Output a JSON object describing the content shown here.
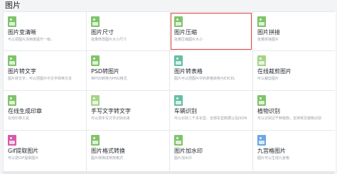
{
  "section": {
    "title": "图片"
  },
  "cards": [
    {
      "title": "图片变清晰",
      "desc": "可以把图片清晰度提升一级。",
      "icon": "image-enhance-icon",
      "color": "#7fc46a",
      "selected": false
    },
    {
      "title": "图片尺寸",
      "desc": "批量修改图片大小尺寸",
      "icon": "image-resize-icon",
      "color": "#7fc46a",
      "selected": false
    },
    {
      "title": "图片压缩",
      "desc": "批量压缩图片大小",
      "icon": "image-compress-icon",
      "color": "#7fc46a",
      "selected": true
    },
    {
      "title": "图片拼接",
      "desc": "批量拼接图片",
      "icon": "image-stitch-icon",
      "color": "#7fc46a",
      "selected": false
    },
    {
      "title": "图片转文字",
      "desc": "图片转文字，可以把图片中文字转换文本",
      "icon": "image-to-text-icon",
      "color": "#7fc46a",
      "selected": false
    },
    {
      "title": "PSD转图片",
      "desc": "将PSD转换为PNG格式",
      "icon": "psd-to-image-icon",
      "color": "#7fc46a",
      "selected": false
    },
    {
      "title": "图片转表格",
      "desc": "图片可以把图片中的表格转换为EXCEL",
      "icon": "image-to-table-icon",
      "color": "#65bfa3",
      "selected": false
    },
    {
      "title": "在线裁剪图片",
      "desc": "可以裁剪图片",
      "icon": "image-crop-icon",
      "color": "#a5d487",
      "selected": false
    },
    {
      "title": "在线生成印章",
      "desc": "在线印章工具",
      "icon": "seal-generator-icon",
      "color": "#7fc46a",
      "selected": false
    },
    {
      "title": "手写文字转文字",
      "desc": "可以把手写文字识别出来",
      "icon": "handwriting-icon",
      "color": "#a5d487",
      "selected": false
    },
    {
      "title": "车辆识别",
      "desc": "可以识别二千多车型、全部车型数据以及JSON",
      "icon": "vehicle-recognition-icon",
      "color": "#65bfa3",
      "selected": false
    },
    {
      "title": "植物识别",
      "desc": "可以识别过千种植物，支持常见植物识别",
      "icon": "plant-recognition-icon",
      "color": "#7fc46a",
      "selected": false
    },
    {
      "title": "Gif提取图片",
      "desc": "可以把GIF提取图片",
      "icon": "gif-extract-icon",
      "color": "#d65aa8",
      "selected": false
    },
    {
      "title": "图片格式转换",
      "desc": "图片转换成常用格式",
      "icon": "image-format-icon",
      "color": "#7fc46a",
      "selected": false
    },
    {
      "title": "图片加水印",
      "desc": "图片加水印",
      "icon": "image-watermark-icon",
      "color": "#7fc46a",
      "selected": false
    },
    {
      "title": "九宫格图片",
      "desc": "图片可以生成九宫格",
      "icon": "nine-grid-icon",
      "color": "#6ca7e6",
      "selected": false
    }
  ]
}
